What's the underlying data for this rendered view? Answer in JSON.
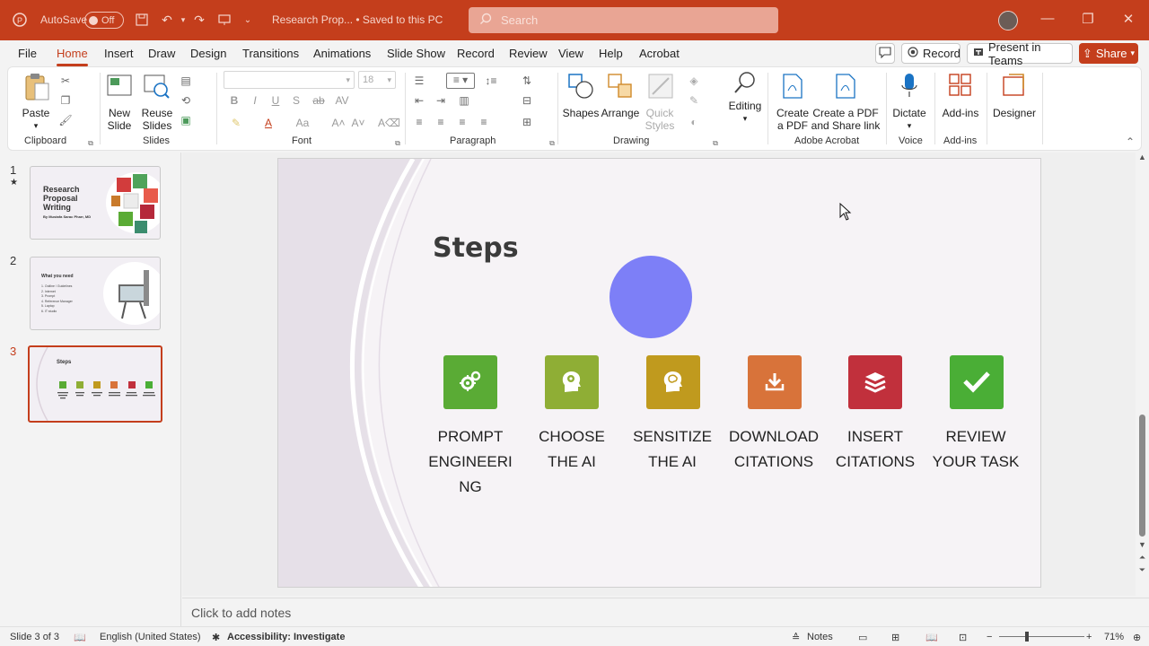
{
  "titlebar": {
    "autosave_label": "AutoSave",
    "autosave_state": "Off",
    "doc_title": "Research Prop... • Saved to this PC",
    "search_placeholder": "Search"
  },
  "menu": {
    "items": [
      "File",
      "Home",
      "Insert",
      "Draw",
      "Design",
      "Transitions",
      "Animations",
      "Slide Show",
      "Record",
      "Review",
      "View",
      "Help",
      "Acrobat"
    ],
    "active": "Home",
    "record_label": "Record",
    "present_label": "Present in Teams",
    "share_label": "Share"
  },
  "ribbon": {
    "groups": [
      "Clipboard",
      "Slides",
      "Font",
      "Paragraph",
      "Drawing",
      "Adobe Acrobat",
      "Voice",
      "Add-ins"
    ],
    "paste": "Paste",
    "new_slide": [
      "New",
      "Slide"
    ],
    "reuse_slides": [
      "Reuse",
      "Slides"
    ],
    "font_size": "18",
    "shapes": "Shapes",
    "arrange": "Arrange",
    "quick_styles": [
      "Quick",
      "Styles"
    ],
    "editing": "Editing",
    "create_pdf": [
      "Create",
      "a PDF"
    ],
    "create_share": [
      "Create a PDF",
      "and Share link"
    ],
    "dictate": "Dictate",
    "addins": "Add-ins",
    "designer": "Designer"
  },
  "thumbnails": [
    {
      "num": "1",
      "title": "Research Proposal Writing",
      "subtitle": "By Mustafa Sarac Pharr, MD"
    },
    {
      "num": "2",
      "title": "What you need",
      "items": [
        "1. Outline / Guidelines",
        "2. Internet",
        "3. Prompt",
        "4. Reference Manager",
        "5. Laptop",
        "6. IT studio"
      ]
    },
    {
      "num": "3",
      "title": "Steps"
    }
  ],
  "slide": {
    "title": "Steps",
    "circle_color": "#7d7ff7",
    "steps": [
      {
        "label": "PROMPT ENGINEERI NG",
        "lines": [
          "PROMPT",
          "ENGINEERI",
          "NG"
        ],
        "color": "#5aab35",
        "icon": "gears-icon"
      },
      {
        "label": "CHOOSE THE AI",
        "lines": [
          "CHOOSE",
          "THE AI"
        ],
        "color": "#8fae35",
        "icon": "head-gear-icon"
      },
      {
        "label": "SENSITIZE THE AI",
        "lines": [
          "SENSITIZE",
          "THE AI"
        ],
        "color": "#c09a1e",
        "icon": "brain-head-icon"
      },
      {
        "label": "DOWNLOAD CITATIONS",
        "lines": [
          "DOWNLOAD",
          "CITATIONS"
        ],
        "color": "#d8733a",
        "icon": "download-icon"
      },
      {
        "label": "INSERT CITATIONS",
        "lines": [
          "INSERT",
          "CITATIONS"
        ],
        "color": "#c1303c",
        "icon": "books-icon"
      },
      {
        "label": "REVIEW YOUR TASK",
        "lines": [
          "REVIEW",
          "YOUR TASK"
        ],
        "color": "#4aae36",
        "icon": "checkmark-icon"
      }
    ]
  },
  "notes_placeholder": "Click to add notes",
  "status": {
    "slide_info": "Slide 3 of 3",
    "language": "English (United States)",
    "accessibility": "Accessibility: Investigate",
    "notes_label": "Notes",
    "zoom": "71%"
  }
}
